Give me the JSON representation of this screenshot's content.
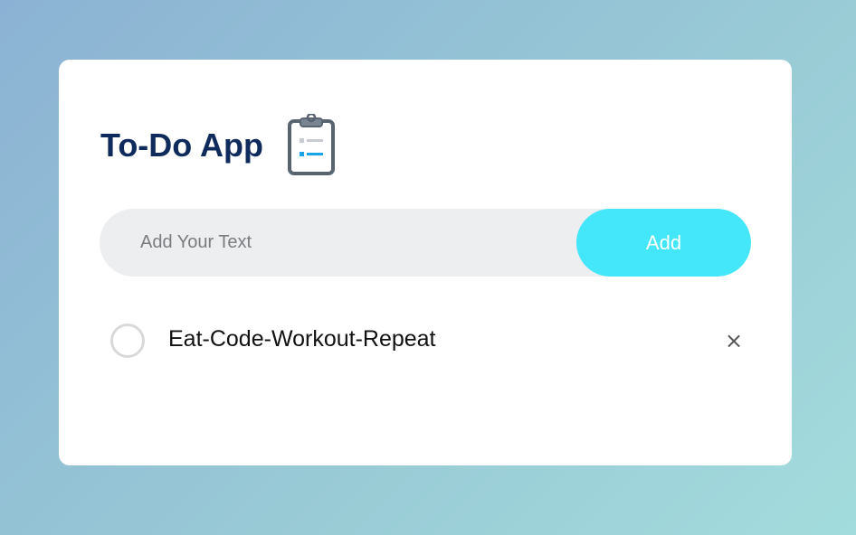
{
  "app": {
    "title": "To-Do App",
    "icon": "clipboard-list-icon"
  },
  "input": {
    "placeholder": "Add Your Text",
    "value": "",
    "add_label": "Add"
  },
  "tasks": [
    {
      "text": "Eat-Code-Workout-Repeat",
      "checked": false,
      "delete_icon": "close-icon",
      "delete_glyph": "×"
    }
  ],
  "colors": {
    "title": "#0f2b5b",
    "add_button": "#44e6fa",
    "input_bg": "#edeef0",
    "checkbox_border": "#d9d9d9",
    "background_start": "#8bb2d4",
    "background_end": "#a3dcdd"
  }
}
